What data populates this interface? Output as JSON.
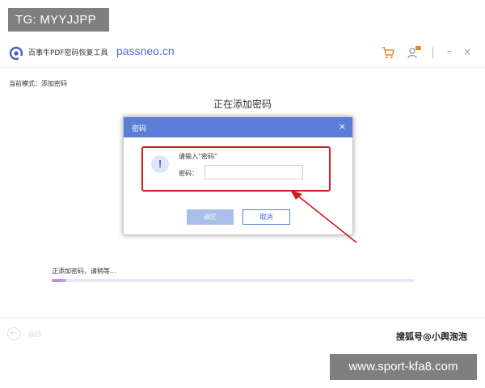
{
  "watermark_top": "TG: MYYJJPP",
  "watermark_bottom": "www.sport-kfa8.com",
  "app": {
    "title": "百事牛PDF密码恢复工具",
    "brand": "passneo.cn",
    "logo_icon": "app-logo-icon",
    "toolbar": {
      "cart_icon": "cart-icon",
      "user_icon": "user-vip-icon",
      "minimize": "–",
      "close": "×"
    }
  },
  "mode_label": "当前模式：添加密码",
  "page_heading": "正在添加密码",
  "dialog": {
    "title": "密码",
    "close": "×",
    "icon_symbol": "!",
    "prompt": "请输入“密码”",
    "field_label": "密码：",
    "password_value": "",
    "ok_label": "确定",
    "cancel_label": "取消"
  },
  "progress": {
    "label": "正添加密码，请稍等...",
    "percent": 4
  },
  "back": {
    "icon": "←",
    "label": "返回"
  },
  "sohu_tag": "搜狐号@小舆泡泡",
  "colors": {
    "accent": "#5b7fd6",
    "highlight": "#d11a1a",
    "progress": "#d87ad6"
  }
}
